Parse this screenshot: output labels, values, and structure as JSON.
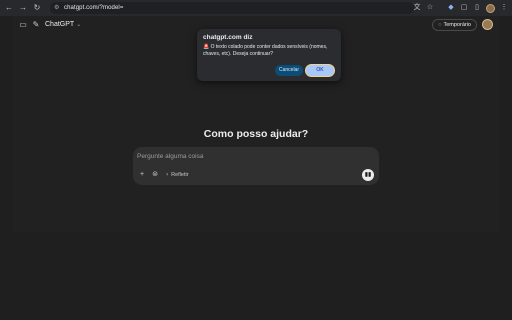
{
  "browser": {
    "url": "chatgpt.com/?model=",
    "icons": {
      "back": "back-arrow-icon",
      "forward": "forward-arrow-icon",
      "reload": "reload-icon",
      "site_info": "site-info-icon",
      "translate": "translate-icon",
      "bookmark": "star-icon",
      "extension": "extension-icon",
      "extensions": "puzzle-icon",
      "split": "split-view-icon",
      "menu": "kebab-menu-icon"
    }
  },
  "header": {
    "model_name": "ChatGPT",
    "temporary_label": "Temporário",
    "icons": {
      "sidebar": "sidebar-toggle-icon",
      "new_chat": "new-chat-icon",
      "temporary": "dashed-circle-icon"
    }
  },
  "main": {
    "headline": "Como posso ajudar?",
    "placeholder": "Pergunte alguma coisa",
    "reason_label": "Refletir"
  },
  "dialog": {
    "title": "chatgpt.com diz",
    "message": "🚨 O texto colado pode conter dados sensíveis (nomes, chaves, etc). Deseja continuar?",
    "cancel_label": "Cancelar",
    "ok_label": "OK"
  },
  "colors": {
    "page_bg": "#212121",
    "composer_bg": "#303030",
    "dialog_bg": "#2b2c2f",
    "ok_button": "#a8c7fa",
    "cancel_button": "#0b4d76"
  }
}
